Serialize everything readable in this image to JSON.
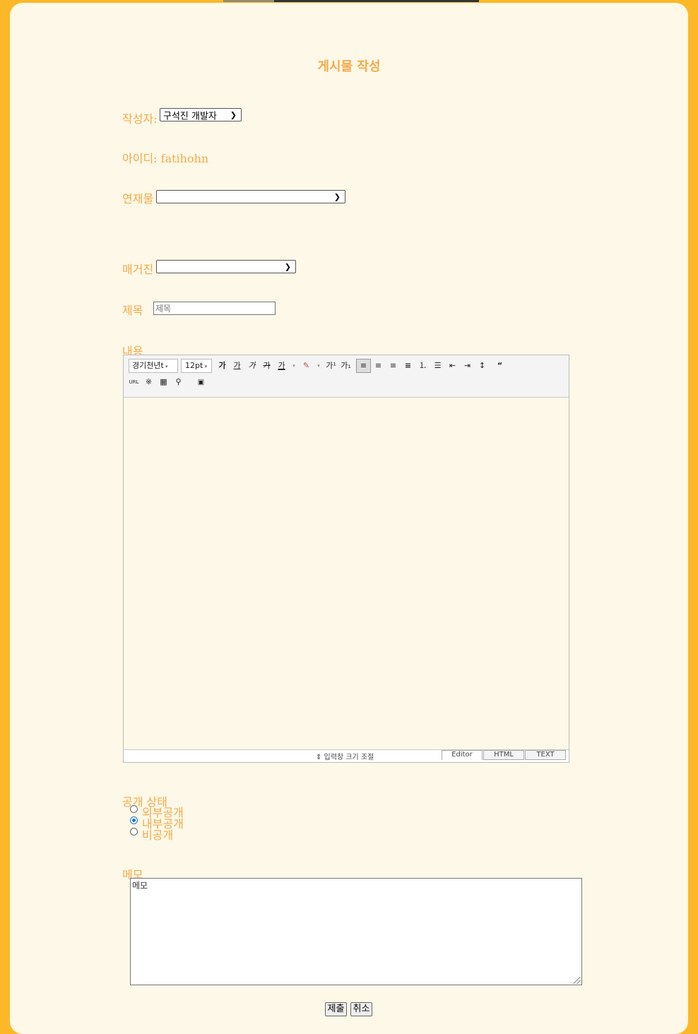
{
  "page": {
    "title": "게시물 작성"
  },
  "form": {
    "author_label": "작성자:",
    "author_value": "구석진 개발자",
    "id_label": "아이디:",
    "id_value": "fatihohn",
    "series_label": "연재물",
    "series_value": "",
    "magazine_label": "매거진",
    "magazine_value": "",
    "subject_label": "제목",
    "subject_placeholder": "제목",
    "content_label": "내용",
    "visibility_label": "공개 상태",
    "visibility_options": [
      {
        "label": "외부공개",
        "checked": false
      },
      {
        "label": "내부공개",
        "checked": true
      },
      {
        "label": "비공개",
        "checked": false
      }
    ],
    "memo_label": "메모",
    "memo_placeholder": "메모",
    "submit_label": "제출",
    "cancel_label": "취소"
  },
  "editor": {
    "font_value": "경기천년t",
    "size_value": "12pt",
    "resize_label": "⇕ 입력창 크기 조절",
    "tabs": [
      "Editor",
      "HTML",
      "TEXT"
    ],
    "active_tab": "Editor",
    "toolbar_icons": [
      "bold-icon",
      "underline-icon",
      "italic-icon",
      "strikethrough-icon",
      "text-color-icon",
      "highlight-icon",
      "superscript-icon",
      "subscript-icon",
      "align-left-icon",
      "align-center-icon",
      "align-right-icon",
      "align-justify-icon",
      "ordered-list-icon",
      "bullet-list-icon",
      "outdent-icon",
      "indent-icon",
      "line-height-icon",
      "quote-icon",
      "link-icon",
      "special-char-icon",
      "table-icon",
      "find-icon",
      "image-icon"
    ]
  }
}
